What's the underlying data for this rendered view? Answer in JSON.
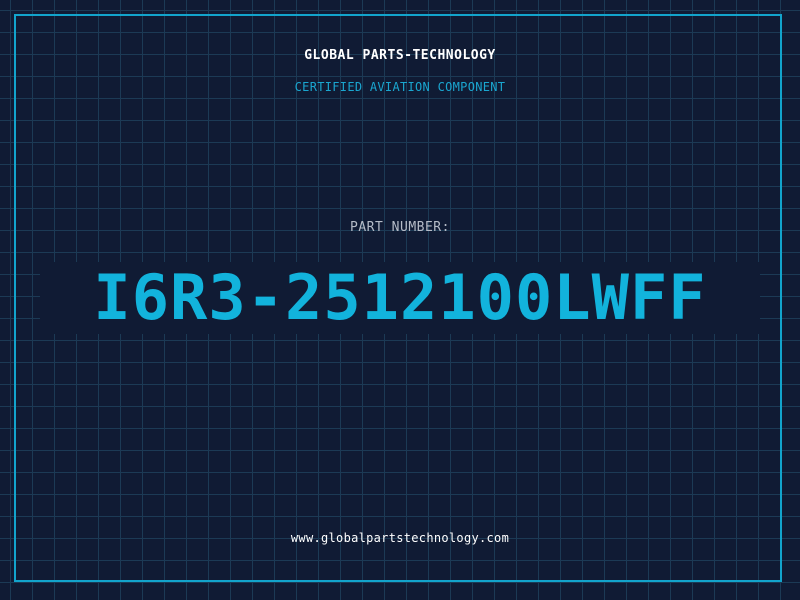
{
  "header": {
    "company": "GLOBAL PARTS-TECHNOLOGY",
    "tagline": "CERTIFIED AVIATION COMPONENT"
  },
  "part": {
    "label": "PART NUMBER:",
    "number": "I6R3-2512100LWFF"
  },
  "footer": {
    "website": "www.globalpartstechnology.com"
  },
  "colors": {
    "background": "#101b34",
    "grid": "#1c3a55",
    "accent": "#12b3dc",
    "frame": "#12a4cc",
    "text": "#ffffff"
  }
}
